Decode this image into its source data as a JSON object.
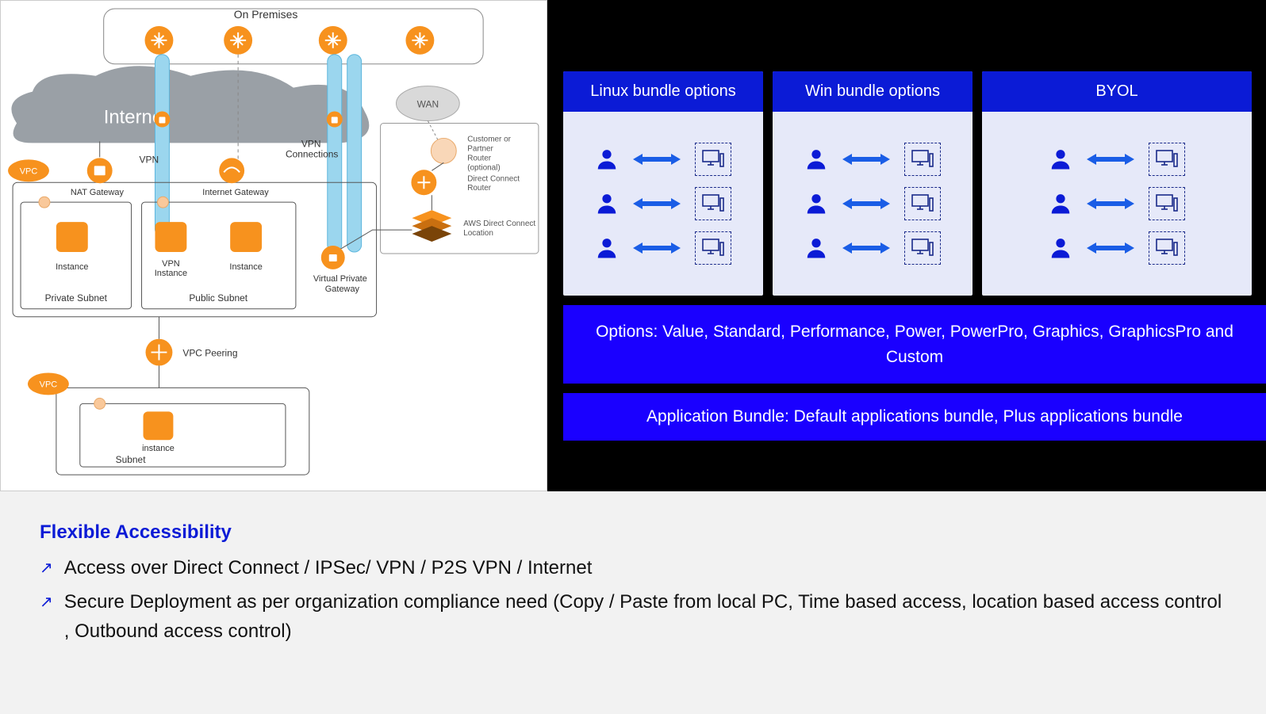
{
  "diagram": {
    "on_premises": "On Premises",
    "internet": "Internet",
    "wan": "WAN",
    "vpn": "VPN",
    "vpn_connections": "VPN\nConnections",
    "customer_router": "Customer or\nPartner\nRouter\n(optional)",
    "direct_connect_router": "Direct Connect\nRouter",
    "aws_dc_location": "AWS Direct Connect\nLocation",
    "vpc": "VPC",
    "nat_gateway": "NAT Gateway",
    "internet_gateway": "Internet Gateway",
    "instance": "Instance",
    "vpn_instance": "VPN\nInstance",
    "instance2": "Instance",
    "virtual_private_gateway": "Virtual Private\nGateway",
    "private_subnet": "Private Subnet",
    "public_subnet": "Public Subnet",
    "vpc_peering": "VPC Peering",
    "subnet": "Subnet",
    "instance3": "instance"
  },
  "bundles": {
    "cards": [
      {
        "title": "Linux bundle options"
      },
      {
        "title": "Win bundle options"
      },
      {
        "title": "BYOL"
      }
    ],
    "options_text": "Options: Value, Standard, Performance, Power, PowerPro, Graphics, GraphicsPro and Custom",
    "app_bundle_text": "Application Bundle: Default applications bundle, Plus applications bundle"
  },
  "bottom": {
    "title": "Flexible Accessibility",
    "bullets": [
      "Access over Direct Connect / IPSec/ VPN / P2S VPN / Internet",
      "Secure Deployment as per organization compliance need (Copy / Paste from local PC, Time based access, location based access control , Outbound access control)"
    ]
  },
  "colors": {
    "blue": "#0b1bd6",
    "orange": "#f7921e",
    "lightblue": "#9bd6ee"
  }
}
